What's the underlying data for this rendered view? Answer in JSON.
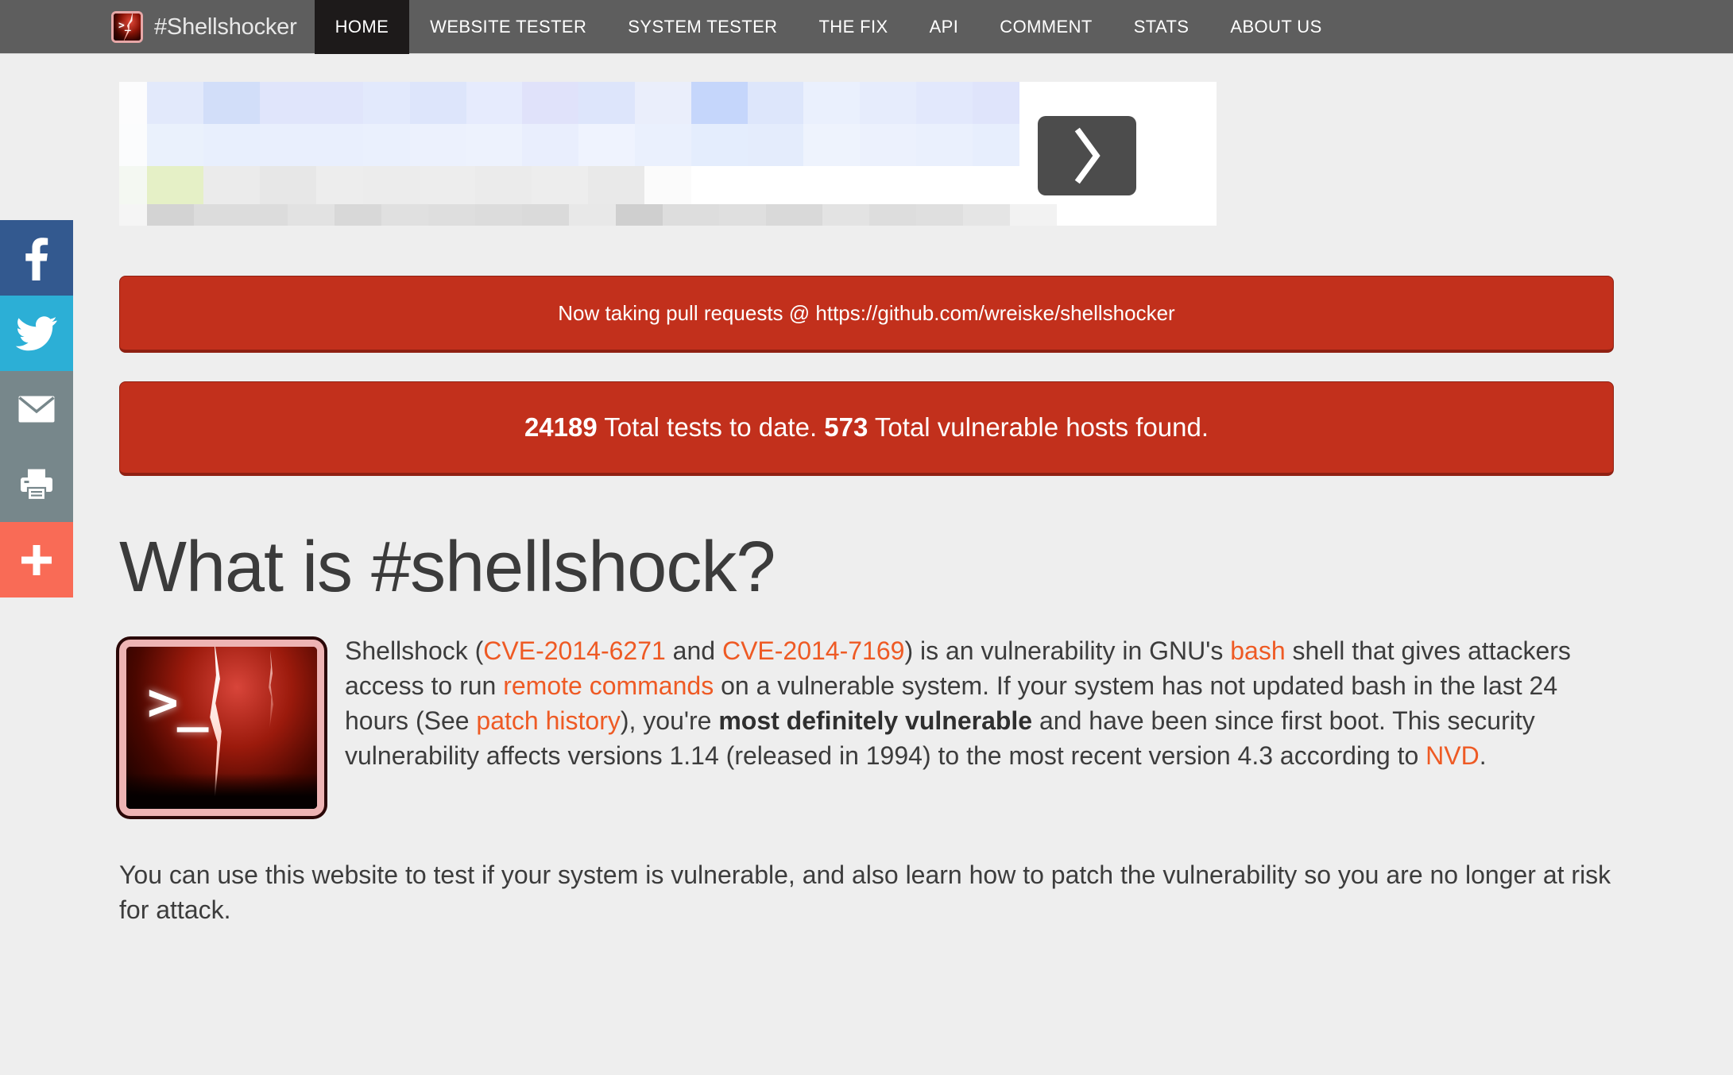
{
  "brand": {
    "label": "#Shellshocker",
    "logo_icon": "shellshock-terminal-lightning-icon"
  },
  "nav": {
    "items": [
      {
        "label": "HOME",
        "active": true
      },
      {
        "label": "WEBSITE TESTER",
        "active": false
      },
      {
        "label": "SYSTEM TESTER",
        "active": false
      },
      {
        "label": "THE FIX",
        "active": false
      },
      {
        "label": "API",
        "active": false
      },
      {
        "label": "COMMENT",
        "active": false
      },
      {
        "label": "STATS",
        "active": false
      },
      {
        "label": "ABOUT US",
        "active": false
      }
    ]
  },
  "social": {
    "items": [
      {
        "name": "facebook",
        "icon": "facebook-icon",
        "color": "#33598f"
      },
      {
        "name": "twitter",
        "icon": "twitter-icon",
        "color": "#2cafd6"
      },
      {
        "name": "email",
        "icon": "envelope-icon",
        "color": "#77878b"
      },
      {
        "name": "print",
        "icon": "printer-icon",
        "color": "#77878b"
      },
      {
        "name": "more",
        "icon": "plus-icon",
        "color": "#f96b56"
      }
    ]
  },
  "ad": {
    "redacted": true,
    "next_icon": "chevron-right-icon"
  },
  "banners": {
    "pull_requests": "Now taking pull requests @ https://github.com/wreiske/shellshocker",
    "stats": {
      "total_tests": "24189",
      "total_tests_label": " Total tests to date. ",
      "vulnerable_hosts": "573",
      "vulnerable_hosts_label": " Total vulnerable hosts found."
    },
    "color": "#c2301c"
  },
  "article": {
    "title": "What is #shellshock?",
    "logo_icon": "shellshock-terminal-lightning-icon",
    "p1": {
      "t1": "Shellshock (",
      "link_cve1": "CVE-2014-6271",
      "t2": " and ",
      "link_cve2": "CVE-2014-7169",
      "t3": ") is an vulnerability in GNU's ",
      "link_bash": "bash",
      "t4": " shell that gives attackers access to run ",
      "link_remote": "remote commands",
      "t5": " on a vulnerable system. If your system has not updated bash in the last 24 hours (See ",
      "link_patch": "patch history",
      "t6": "), you're ",
      "bold1": "most definitely vulnerable",
      "t7": " and have been since first boot. This security vulnerability affects versions 1.14 (released in 1994) to the most recent version 4.3 according to ",
      "link_nvd": "NVD",
      "t8": "."
    },
    "p2": "You can use this website to test if your system is vulnerable, and also learn how to patch the vulnerability so you are no longer at risk for attack."
  },
  "colors": {
    "navbar_bg": "#5e5e5e",
    "nav_active_bg": "#1d1a1a",
    "page_bg": "#eeeeee",
    "accent_link": "#ee5a24",
    "banner_red": "#c2301c",
    "banner_red_dark": "#8f2012"
  }
}
